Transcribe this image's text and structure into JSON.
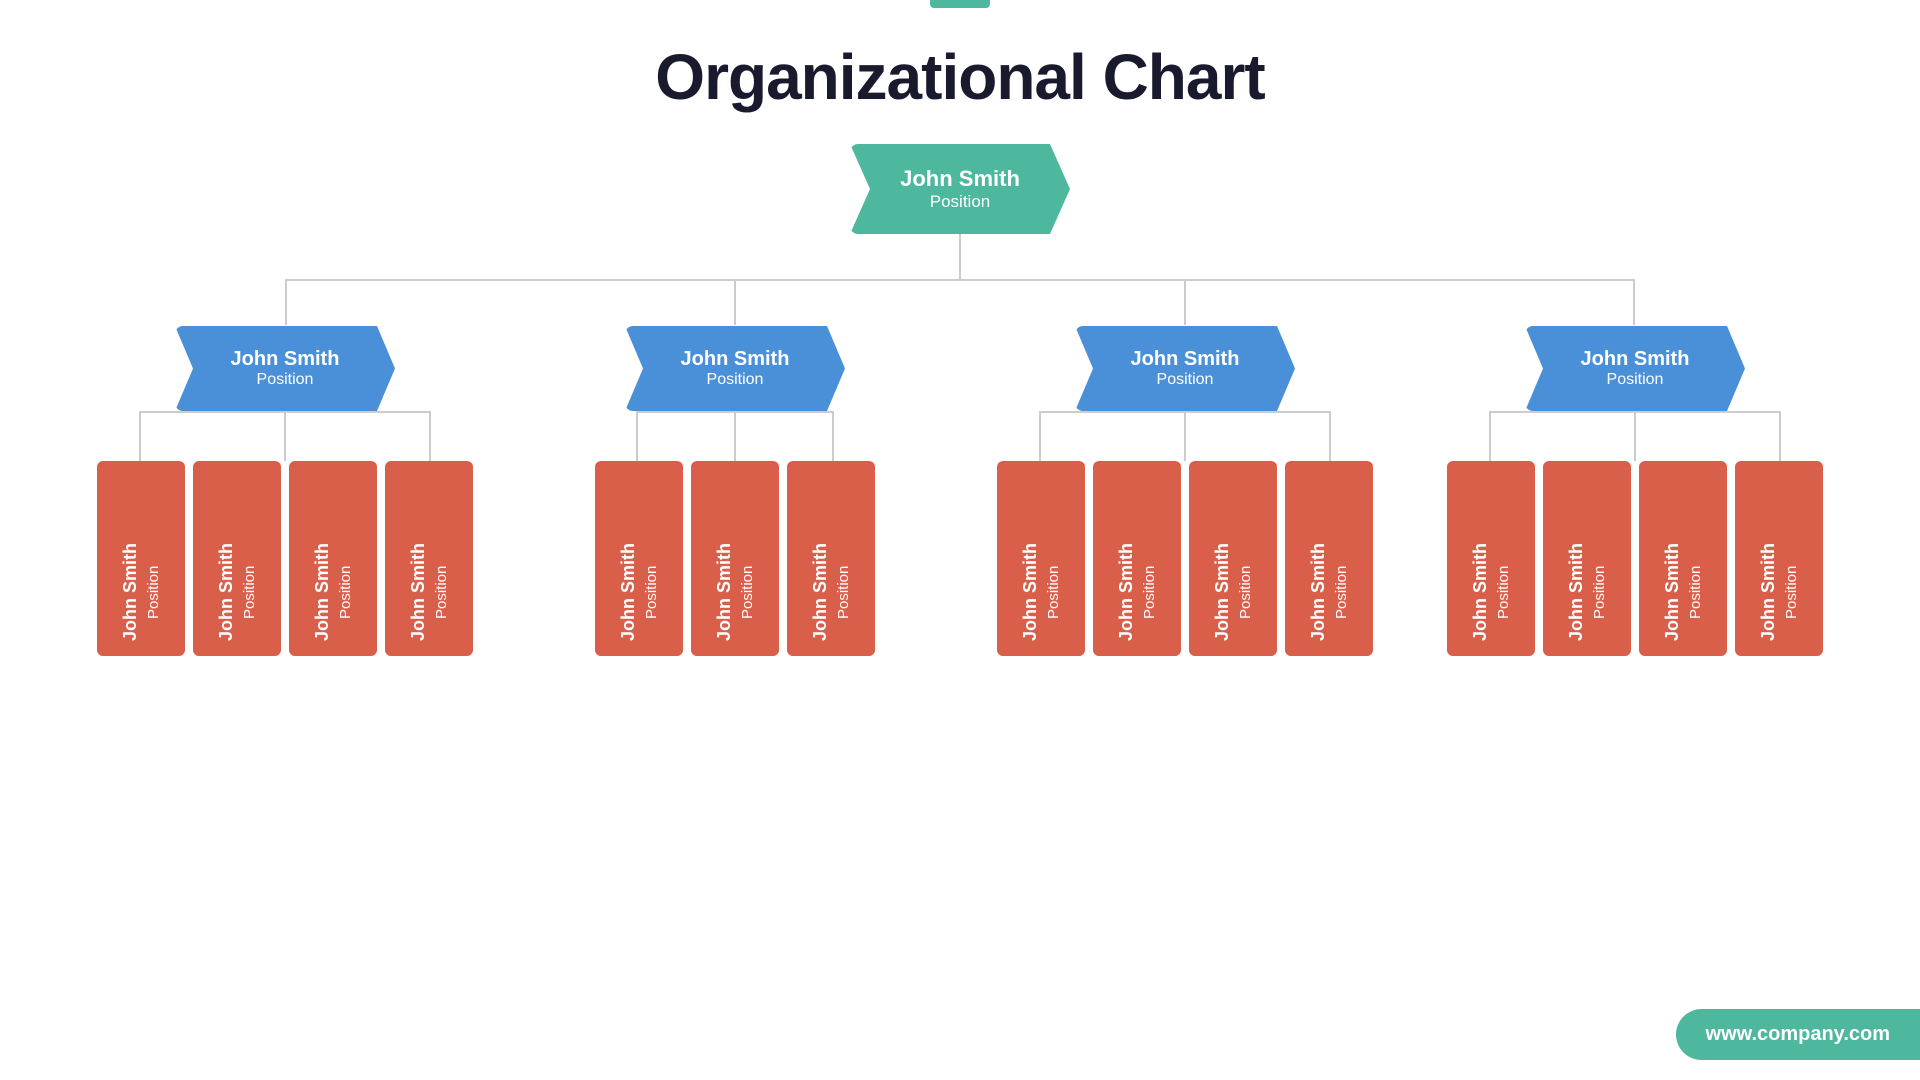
{
  "page": {
    "title": "Organizational Chart",
    "accent_color": "#4db89e",
    "website": "www.company.com"
  },
  "top_node": {
    "name": "John Smith",
    "position": "Position"
  },
  "level2_nodes": [
    {
      "name": "John Smith",
      "position": "Position",
      "children_count": 4
    },
    {
      "name": "John Smith",
      "position": "Position",
      "children_count": 3
    },
    {
      "name": "John Smith",
      "position": "Position",
      "children_count": 4
    },
    {
      "name": "John Smith",
      "position": "Position",
      "children_count": 4
    }
  ],
  "level3_node": {
    "name": "John Smith",
    "position": "Position"
  }
}
